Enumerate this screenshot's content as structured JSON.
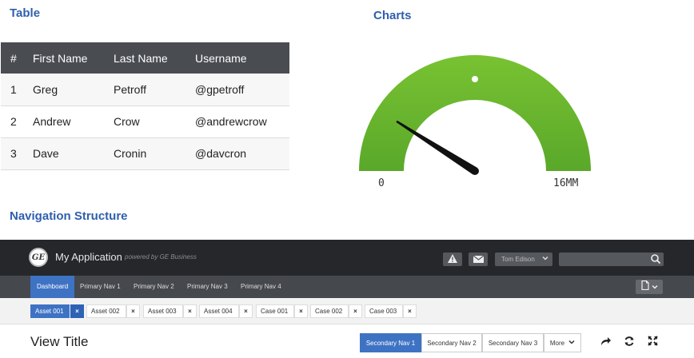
{
  "sections": {
    "table_title": "Table",
    "charts_title": "Charts",
    "nav_title": "Navigation Structure"
  },
  "table": {
    "headers": [
      "#",
      "First Name",
      "Last Name",
      "Username"
    ],
    "rows": [
      [
        "1",
        "Greg",
        "Petroff",
        "@gpetroff"
      ],
      [
        "2",
        "Andrew",
        "Crow",
        "@andrewcrow"
      ],
      [
        "3",
        "Dave",
        "Cronin",
        "@davcron"
      ]
    ]
  },
  "gauge": {
    "min_label": "0",
    "max_label": "16MM",
    "needle_fraction": 0.18,
    "arc_color": "#6ab72e",
    "needle_color": "#111111"
  },
  "app": {
    "logo_text": "GE",
    "name": "My Application",
    "powered_by": "powered by GE Business",
    "user": "Tom Edison",
    "search_placeholder": ""
  },
  "primary_nav": [
    "Dashboard",
    "Primary Nav 1",
    "Primary Nav 2",
    "Primary Nav 3",
    "Primary Nav 4"
  ],
  "assets": [
    "Asset 001",
    "Asset 002",
    "Asset 003",
    "Asset 004",
    "Case 001",
    "Case 002",
    "Case 003"
  ],
  "chip_close": "×",
  "view": {
    "title": "View Title",
    "secondary_nav": [
      "Secondary Nav 1",
      "Secondary Nav 2",
      "Secondary Nav 3",
      "More"
    ]
  },
  "colors": {
    "accent": "#3e73c4",
    "section_title": "#2f5fae",
    "app_header": "#25272b",
    "primary_nav_bg": "#45484d"
  },
  "icons": [
    "warning-icon",
    "mail-icon",
    "chevron-down-icon",
    "search-icon",
    "document-icon",
    "share-icon",
    "refresh-icon",
    "expand-icon"
  ]
}
